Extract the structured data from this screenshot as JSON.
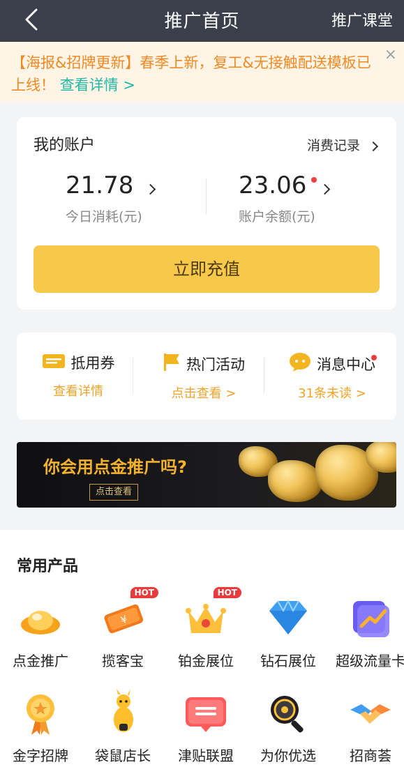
{
  "topbar": {
    "title": "推广首页",
    "right_link": "推广课堂"
  },
  "notice": {
    "text": "【海报&招牌更新】春季上新，复工&无接触配送模板已上线！",
    "link": "查看详情 >",
    "close": "×"
  },
  "account": {
    "title": "我的账户",
    "records": "消费记录",
    "today_value": "21.78",
    "today_label": "今日消耗(元)",
    "balance_value": "23.06",
    "balance_label": "账户余额(元)",
    "charge_button": "立即充值"
  },
  "quick": [
    {
      "title": "抵用券",
      "sub": "查看详情"
    },
    {
      "title": "热门活动",
      "sub": "点击查看 >"
    },
    {
      "title": "消息中心",
      "sub": "31条未读 >"
    }
  ],
  "banner": {
    "headline": "你会用点金推广吗?",
    "button": "点击查看"
  },
  "products": {
    "title": "常用产品",
    "hot_label": "HOT",
    "items": [
      "点金推广",
      "揽客宝",
      "铂金展位",
      "钻石展位",
      "超级流量卡",
      "金字招牌",
      "袋鼠店长",
      "津贴联盟",
      "为你优选",
      "招商荟"
    ]
  },
  "colors": {
    "accent": "#f8c84a",
    "brand_text": "#f08a24",
    "link": "#1fb8a5",
    "alert": "#f03e3e"
  }
}
